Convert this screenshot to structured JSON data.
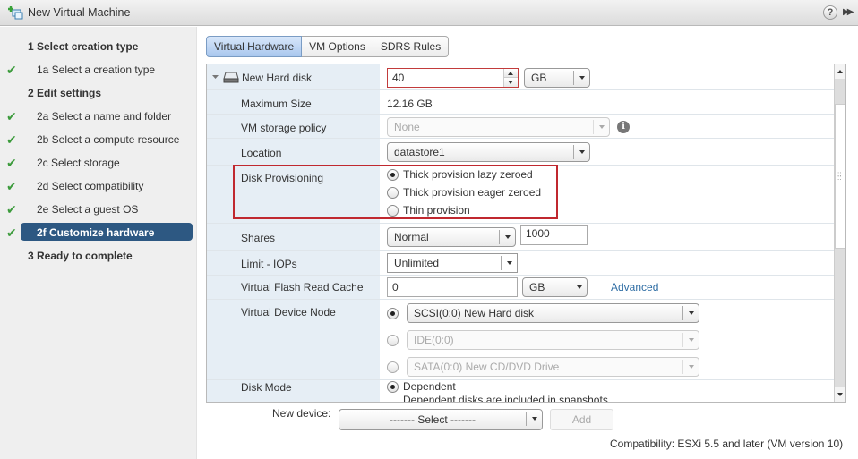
{
  "window": {
    "title": "New Virtual Machine",
    "help_label": "?",
    "expand_label": "▶▶"
  },
  "steps": [
    {
      "label": "1  Select creation type",
      "level": "major",
      "done": false,
      "active": false
    },
    {
      "label": "1a  Select a creation type",
      "level": "minor",
      "done": true,
      "active": false
    },
    {
      "label": "2  Edit settings",
      "level": "major",
      "done": false,
      "active": false
    },
    {
      "label": "2a  Select a name and folder",
      "level": "minor",
      "done": true,
      "active": false
    },
    {
      "label": "2b  Select a compute resource",
      "level": "minor",
      "done": true,
      "active": false
    },
    {
      "label": "2c  Select storage",
      "level": "minor",
      "done": true,
      "active": false
    },
    {
      "label": "2d  Select compatibility",
      "level": "minor",
      "done": true,
      "active": false
    },
    {
      "label": "2e  Select a guest OS",
      "level": "minor",
      "done": true,
      "active": false
    },
    {
      "label": "2f  Customize hardware",
      "level": "minor",
      "done": true,
      "active": true
    },
    {
      "label": "3  Ready to complete",
      "level": "major",
      "done": false,
      "active": false
    }
  ],
  "check_glyph": "✔",
  "tabs": [
    {
      "label": "Virtual Hardware",
      "active": true
    },
    {
      "label": "VM Options",
      "active": false
    },
    {
      "label": "SDRS Rules",
      "active": false
    }
  ],
  "hardware": {
    "device": {
      "label": "New Hard disk",
      "size_value": "40",
      "size_unit": "GB"
    },
    "max_size": {
      "label": "Maximum Size",
      "value": "12.16 GB"
    },
    "storage_policy": {
      "label": "VM storage policy",
      "value": "None",
      "info": "i"
    },
    "location": {
      "label": "Location",
      "value": "datastore1"
    },
    "provisioning": {
      "label": "Disk Provisioning",
      "options": [
        {
          "label": "Thick provision lazy zeroed",
          "selected": true
        },
        {
          "label": "Thick provision eager zeroed",
          "selected": false
        },
        {
          "label": "Thin provision",
          "selected": false
        }
      ]
    },
    "shares": {
      "label": "Shares",
      "level": "Normal",
      "value": "1000"
    },
    "limit_iops": {
      "label": "Limit - IOPs",
      "value": "Unlimited"
    },
    "flash_cache": {
      "label": "Virtual Flash Read Cache",
      "value": "0",
      "unit": "GB",
      "advanced_link": "Advanced"
    },
    "device_node": {
      "label": "Virtual Device Node",
      "options": [
        {
          "label": "SCSI(0:0) New Hard disk",
          "selected": true,
          "enabled": true
        },
        {
          "label": "IDE(0:0)",
          "selected": false,
          "enabled": false
        },
        {
          "label": "SATA(0:0) New CD/DVD Drive",
          "selected": false,
          "enabled": false
        }
      ]
    },
    "disk_mode": {
      "label": "Disk Mode",
      "value": "Dependent",
      "description": "Dependent disks are included in snapshots."
    }
  },
  "footer": {
    "new_device_label": "New device:",
    "new_device_select": "------- Select -------",
    "add_label": "Add",
    "compatibility": "Compatibility: ESXi 5.5 and later (VM version 10)"
  },
  "scroll": {
    "position_fraction": 0.2
  }
}
